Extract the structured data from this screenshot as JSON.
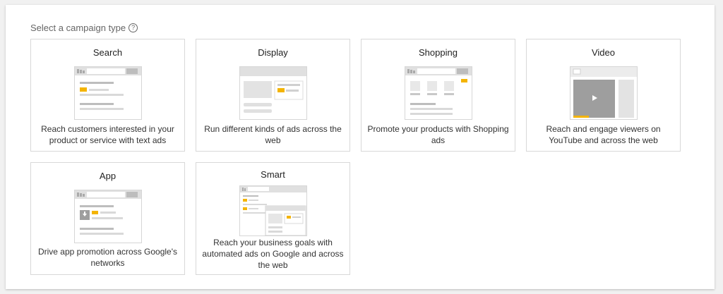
{
  "page": {
    "heading": "Select a campaign type",
    "help_icon": "help-circle-icon"
  },
  "colors": {
    "accent": "#f4b400",
    "card_border": "#d8d8d8",
    "illustration_gray": "#d9d9d9",
    "illustration_dark": "#9e9e9e"
  },
  "campaign_types": [
    {
      "title": "Search",
      "description": "Reach customers interested in your product or service with text ads"
    },
    {
      "title": "Display",
      "description": "Run different kinds of ads across the web"
    },
    {
      "title": "Shopping",
      "description": "Promote your products with Shopping ads"
    },
    {
      "title": "Video",
      "description": "Reach and engage viewers on YouTube and across the web"
    },
    {
      "title": "App",
      "description": "Drive app promotion across Google's networks"
    },
    {
      "title": "Smart",
      "description": "Reach your business goals with automated ads on Google and across the web"
    }
  ]
}
